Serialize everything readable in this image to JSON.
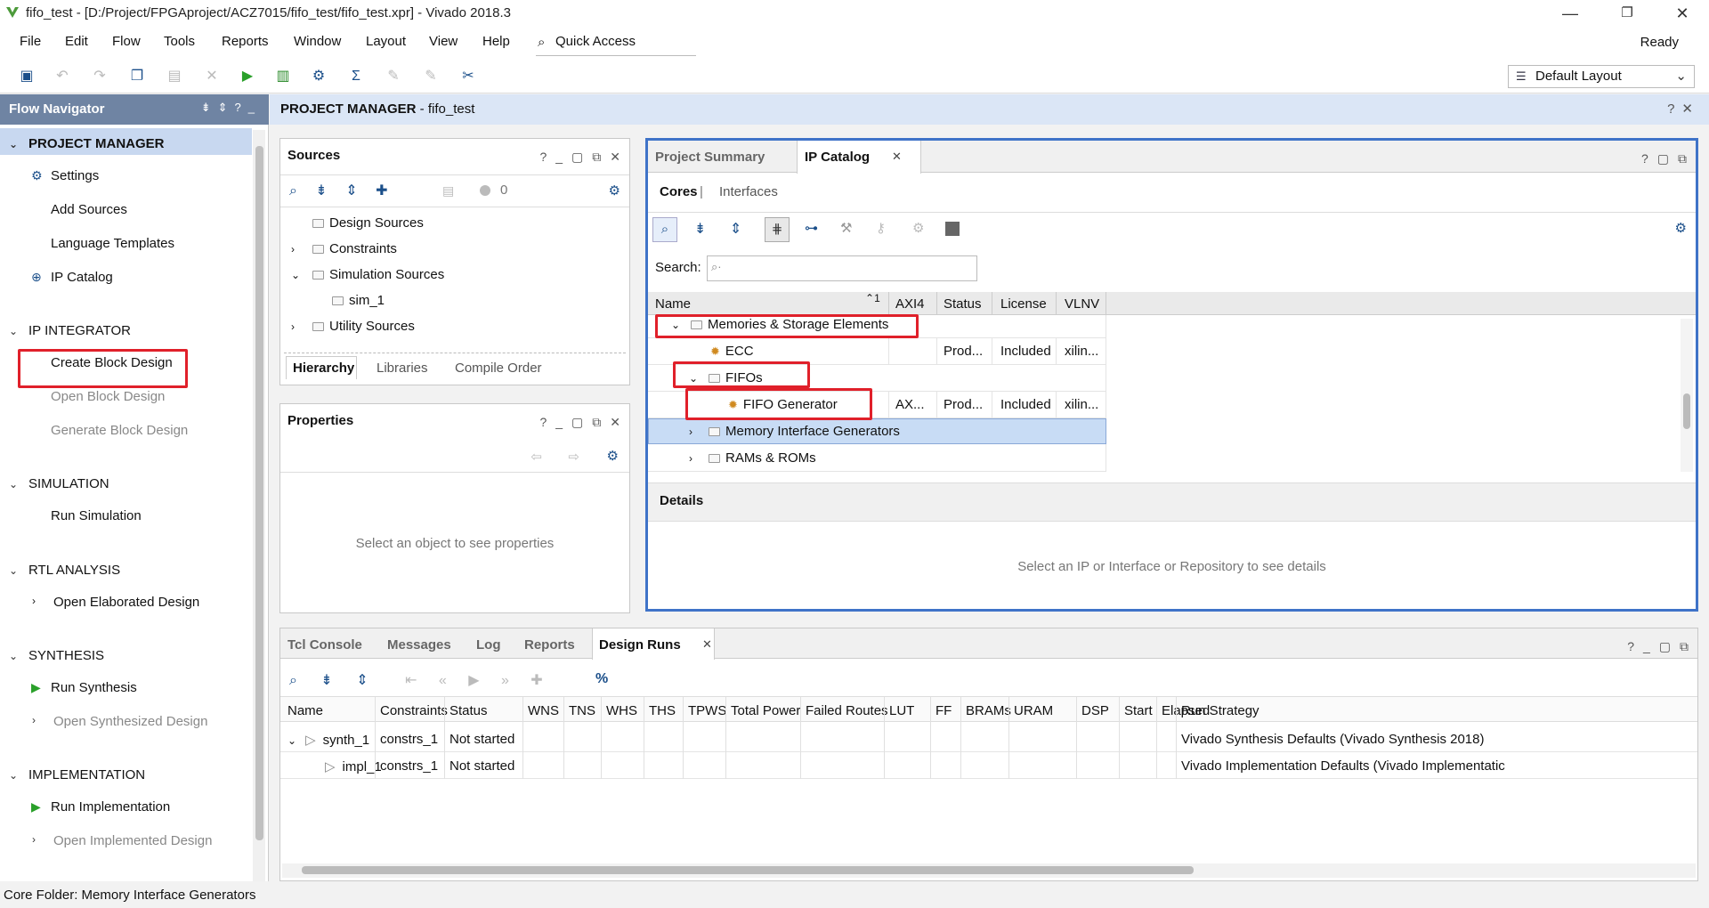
{
  "window": {
    "title": "fifo_test - [D:/Project/FPGAproject/ACZ7015/fifo_test/fifo_test.xpr] - Vivado 2018.3",
    "minimize": "—",
    "restore": "❐",
    "close": "✕"
  },
  "menu": [
    "File",
    "Edit",
    "Flow",
    "Tools",
    "Reports",
    "Window",
    "Layout",
    "View",
    "Help"
  ],
  "quick_access": "Quick Access",
  "status_ready": "Ready",
  "layout_select": "Default Layout",
  "flow_nav": {
    "title": "Flow Navigator",
    "sections": {
      "pm": "PROJECT MANAGER",
      "ipi": "IP INTEGRATOR",
      "sim": "SIMULATION",
      "rtl": "RTL ANALYSIS",
      "syn": "SYNTHESIS",
      "impl": "IMPLEMENTATION"
    },
    "items": {
      "settings": "Settings",
      "add_sources": "Add Sources",
      "lang_templates": "Language Templates",
      "ip_catalog": "IP Catalog",
      "create_bd": "Create Block Design",
      "open_bd": "Open Block Design",
      "gen_bd": "Generate Block Design",
      "run_sim": "Run Simulation",
      "open_elab": "Open Elaborated Design",
      "run_syn": "Run Synthesis",
      "open_syn": "Open Synthesized Design",
      "run_impl": "Run Implementation",
      "open_impl": "Open Implemented Design"
    }
  },
  "pm_header": {
    "title": "PROJECT MANAGER",
    "project": " - fifo_test"
  },
  "sources": {
    "title": "Sources",
    "count": "0",
    "tree": {
      "design": "Design Sources",
      "constraints": "Constraints",
      "simulation": "Simulation Sources",
      "sim1": "sim_1",
      "utility": "Utility Sources"
    },
    "tabs": [
      "Hierarchy",
      "Libraries",
      "Compile Order"
    ]
  },
  "properties": {
    "title": "Properties",
    "empty": "Select an object to see properties"
  },
  "ip_panel": {
    "tabs": [
      "Project Summary",
      "IP Catalog"
    ],
    "subtabs": [
      "Cores",
      "Interfaces"
    ],
    "search_label": "Search:",
    "columns": [
      "Name",
      "AXI4",
      "Status",
      "License",
      "VLNV"
    ],
    "sort_indicator": "1",
    "rows": {
      "mem": "Memories & Storage Elements",
      "ecc": {
        "name": "ECC",
        "axi": "",
        "status": "Prod...",
        "license": "Included",
        "vlnv": "xilin..."
      },
      "fifos": "FIFOs",
      "fifogen": {
        "name": "FIFO Generator",
        "axi": "AX...",
        "status": "Prod...",
        "license": "Included",
        "vlnv": "xilin..."
      },
      "mig": "Memory Interface Generators",
      "rams": "RAMs & ROMs"
    },
    "details_title": "Details",
    "details_empty": "Select an IP or Interface or Repository to see details"
  },
  "runs_panel": {
    "tabs": [
      "Tcl Console",
      "Messages",
      "Log",
      "Reports",
      "Design Runs"
    ],
    "columns": [
      "Name",
      "Constraints",
      "Status",
      "WNS",
      "TNS",
      "WHS",
      "THS",
      "TPWS",
      "Total Power",
      "Failed Routes",
      "LUT",
      "FF",
      "BRAMs",
      "URAM",
      "DSP",
      "Start",
      "Elapsed",
      "Run Strategy"
    ],
    "rows": [
      {
        "name": "synth_1",
        "constraints": "constrs_1",
        "status": "Not started",
        "strategy": "Vivado Synthesis Defaults (Vivado Synthesis 2018)"
      },
      {
        "name": "impl_1",
        "constraints": "constrs_1",
        "status": "Not started",
        "strategy": "Vivado Implementation Defaults (Vivado Implementatic"
      }
    ]
  },
  "statusbar": "Core Folder: Memory Interface Generators",
  "colors": {
    "accent_border": "#3f73c8",
    "highlight": "#e0202a",
    "selection": "#c8d8f0",
    "nav_header": "#6f84a3"
  }
}
